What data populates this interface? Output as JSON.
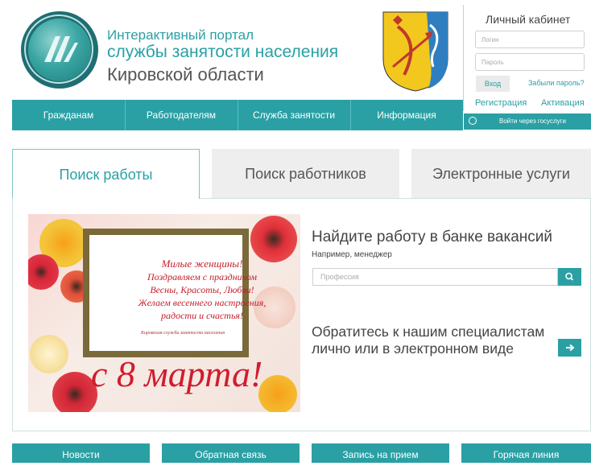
{
  "header": {
    "title_line1": "Интерактивный портал",
    "title_line2": "службы занятости населения",
    "title_line3": "Кировской области"
  },
  "login": {
    "title": "Личный кабинет",
    "login_placeholder": "Логин",
    "password_placeholder": "Пароль",
    "enter_label": "Вход",
    "forgot_label": "Забыли пароль?",
    "register_label": "Регистрация",
    "activate_label": "Активация",
    "gosuslugi_label": "Войти через госуслуги"
  },
  "nav": {
    "items": [
      "Гражданам",
      "Работодателям",
      "Служба занятости",
      "Информация"
    ]
  },
  "tabs": [
    "Поиск работы",
    "Поиск работников",
    "Электронные услуги"
  ],
  "card": {
    "line1": "Милые женщины!",
    "line2": "Поздравляем с праздником",
    "line3": "Весны, Красоты, Любви!",
    "line4": "Желаем весеннего настроения,",
    "line5": "радости и счастья!",
    "signature": "Кировская служба занятости населения",
    "march": "с 8 марта!"
  },
  "search": {
    "heading": "Найдите работу в банке вакансий",
    "example": "Например, менеджер",
    "placeholder": "Профессия"
  },
  "contact": {
    "line1": "Обратитесь к нашим специалистам",
    "line2": "лично или в электронном виде"
  },
  "bottom_buttons": [
    "Новости",
    "Обратная связь",
    "Запись на прием",
    "Горячая линия"
  ],
  "colors": {
    "accent": "#2aa0a5",
    "text": "#444444"
  }
}
